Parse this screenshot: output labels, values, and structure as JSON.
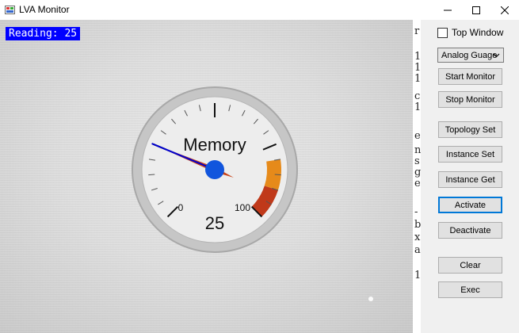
{
  "window": {
    "title": "LVA Monitor"
  },
  "overlay": {
    "reading": "Reading: 25"
  },
  "gauge": {
    "label": "Memory",
    "value": 25,
    "value_text": "25",
    "min_label": "0",
    "max_label": "100",
    "colors": {
      "needle": "#0000cc",
      "hub": "#1155dd",
      "band_orange": "#e68a1a",
      "band_red": "#c0391a"
    }
  },
  "side_strip": {
    "chars": [
      "r",
      "1",
      "1",
      "1",
      "c",
      "1",
      "e",
      "n",
      "s",
      "g",
      "e",
      "-",
      "b",
      "x",
      "a",
      "1"
    ]
  },
  "controls": {
    "top_window_label": "Top Window",
    "top_window_checked": false,
    "display_select": "Analog Guage",
    "buttons": {
      "start_monitor": "Start Monitor",
      "stop_monitor": "Stop Monitor",
      "topology_set": "Topology Set",
      "instance_set": "Instance Set",
      "instance_get": "Instance Get",
      "activate": "Activate",
      "deactivate": "Deactivate",
      "clear": "Clear",
      "exec": "Exec"
    }
  },
  "icons": [
    "app-icon",
    "minimize-icon",
    "maximize-icon",
    "close-icon",
    "chevron-down-icon"
  ],
  "colors": {
    "reading_bg": "#0000ff",
    "focus_border": "#0078d7"
  }
}
